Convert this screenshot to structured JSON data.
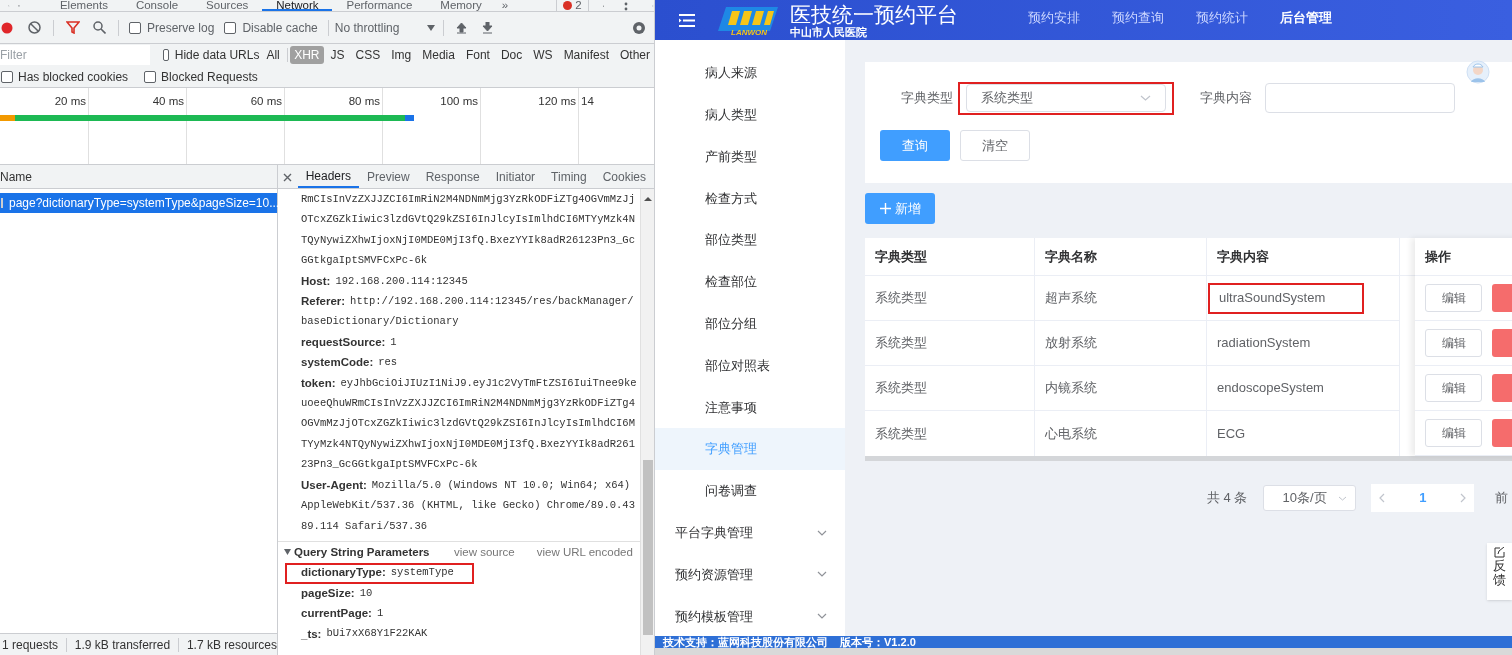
{
  "devtools": {
    "tabs": [
      {
        "label": "Elements",
        "selected": false
      },
      {
        "label": "Console",
        "selected": false
      },
      {
        "label": "Sources",
        "selected": false
      },
      {
        "label": "Network",
        "selected": true
      },
      {
        "label": "Performance",
        "selected": false
      },
      {
        "label": "Memory",
        "selected": false
      }
    ],
    "more_tabs": "»",
    "error_count": "2",
    "toolbar": {
      "recording": true,
      "checkboxes": [
        {
          "label": "Preserve log",
          "checked": false
        },
        {
          "label": "Disable cache",
          "checked": false
        }
      ],
      "throttling": "No throttling"
    },
    "filter": {
      "placeholder": "Filter",
      "hide_data_urls": {
        "label": "Hide data URLs",
        "checked": false
      },
      "types": [
        {
          "label": "All",
          "selected": false
        },
        {
          "label": "XHR",
          "selected": true
        },
        {
          "label": "JS",
          "selected": false
        },
        {
          "label": "CSS",
          "selected": false
        },
        {
          "label": "Img",
          "selected": false
        },
        {
          "label": "Media",
          "selected": false
        },
        {
          "label": "Font",
          "selected": false
        },
        {
          "label": "Doc",
          "selected": false
        },
        {
          "label": "WS",
          "selected": false
        },
        {
          "label": "Manifest",
          "selected": false
        },
        {
          "label": "Other",
          "selected": false
        }
      ],
      "blocked": [
        {
          "label": "Has blocked cookies",
          "checked": false
        },
        {
          "label": "Blocked Requests",
          "checked": false
        }
      ]
    },
    "timeline": {
      "ticks": [
        "20 ms",
        "40 ms",
        "60 ms",
        "80 ms",
        "100 ms",
        "120 ms",
        "14"
      ]
    },
    "requests": {
      "column": "Name",
      "rows": [
        {
          "name": "page?dictionaryType=systemType&pageSize=10...",
          "selected": true
        }
      ]
    },
    "detail_tabs": [
      {
        "label": "Headers",
        "selected": true
      },
      {
        "label": "Preview",
        "selected": false
      },
      {
        "label": "Response",
        "selected": false
      },
      {
        "label": "Initiator",
        "selected": false
      },
      {
        "label": "Timing",
        "selected": false
      },
      {
        "label": "Cookies",
        "selected": false
      }
    ],
    "headers": [
      {
        "value": "RmCIsInVzZXJJZCI6ImRiN2M4NDNmMjg3YzRkODFiZTg4OGVmMzJjOTcxZGZkIiwic3lzdGVtQ29kZSI6InJlcyIsImlhdCI6MTYyMzk4NTQyNywiZXhwIjoxNjI0MDE0MjI3fQ.BxezYYIk8adR26123Pn3_GcGGtkgaIptSMVFCxPc-6k"
      },
      {
        "name": "Host:",
        "value": "192.168.200.114:12345"
      },
      {
        "name": "Referer:",
        "value": "http://192.168.200.114:12345/res/backManager/baseDictionary/Dictionary"
      },
      {
        "name": "requestSource:",
        "value": "1"
      },
      {
        "name": "systemCode:",
        "value": "res"
      },
      {
        "name": "token:",
        "value": "eyJhbGciOiJIUzI1NiJ9.eyJ1c2VyTmFtZSI6IuiTnee9keuoeeQhuWRmCIsInVzZXJJZCI6ImRiN2M4NDNmMjg3YzRkODFiZTg4OGVmMzJjOTcxZGZkIiwic3lzdGVtQ29kZSI6InJlcyIsImlhdCI6MTYyMzk4NTQyNywiZXhwIjoxNjI0MDE0MjI3fQ.BxezYYIk8adR26123Pn3_GcGGtkgaIptSMVFCxPc-6k"
      },
      {
        "name": "User-Agent:",
        "value": "Mozilla/5.0 (Windows NT 10.0; Win64; x64) AppleWebKit/537.36 (KHTML, like Gecko) Chrome/89.0.4389.114 Safari/537.36"
      }
    ],
    "query": {
      "title": "Query String Parameters",
      "expanded": true,
      "links": [
        "view source",
        "view URL encoded"
      ],
      "params": [
        {
          "name": "dictionaryType:",
          "value": "systemType",
          "highlighted": true
        },
        {
          "name": "pageSize:",
          "value": "10",
          "highlighted": false
        },
        {
          "name": "currentPage:",
          "value": "1",
          "highlighted": false
        },
        {
          "name": "_ts:",
          "value": "bUi7xX68Y1F22KAK",
          "highlighted": false
        }
      ]
    },
    "status": [
      "1 requests",
      "1.9 kB transferred",
      "1.7 kB resources"
    ]
  },
  "app": {
    "header": {
      "logo_text": "LANWON",
      "title": "医技统一预约平台",
      "subtitle": "中山市人民医院",
      "nav": [
        {
          "label": "预约安排",
          "selected": false
        },
        {
          "label": "预约查询",
          "selected": false
        },
        {
          "label": "预约统计",
          "selected": false
        },
        {
          "label": "后台管理",
          "selected": true
        }
      ]
    },
    "sidebar": [
      {
        "label": "病人来源",
        "kind": "item",
        "selected": false
      },
      {
        "label": "病人类型",
        "kind": "item",
        "selected": false
      },
      {
        "label": "产前类型",
        "kind": "item",
        "selected": false
      },
      {
        "label": "检查方式",
        "kind": "item",
        "selected": false
      },
      {
        "label": "部位类型",
        "kind": "item",
        "selected": false
      },
      {
        "label": "检查部位",
        "kind": "item",
        "selected": false
      },
      {
        "label": "部位分组",
        "kind": "item",
        "selected": false
      },
      {
        "label": "部位对照表",
        "kind": "item",
        "selected": false
      },
      {
        "label": "注意事项",
        "kind": "item",
        "selected": false
      },
      {
        "label": "字典管理",
        "kind": "item",
        "selected": true
      },
      {
        "label": "问卷调查",
        "kind": "item",
        "selected": false
      },
      {
        "label": "平台字典管理",
        "kind": "group",
        "selected": false
      },
      {
        "label": "预约资源管理",
        "kind": "group",
        "selected": false
      },
      {
        "label": "预约模板管理",
        "kind": "group",
        "selected": false
      }
    ],
    "filters": {
      "type": {
        "label": "字典类型",
        "value": "系统类型",
        "highlighted": true
      },
      "content": {
        "label": "字典内容"
      },
      "buttons": [
        "查询",
        "清空"
      ]
    },
    "add_button": "新增",
    "table": {
      "columns": [
        "字典类型",
        "字典名称",
        "字典内容"
      ],
      "actions_column": "操作",
      "rows": [
        {
          "type": "系统类型",
          "name": "超声系统",
          "content": "ultraSoundSystem",
          "highlighted": true,
          "edit": "编辑"
        },
        {
          "type": "系统类型",
          "name": "放射系统",
          "content": "radiationSystem",
          "highlighted": false,
          "edit": "编辑"
        },
        {
          "type": "系统类型",
          "name": "内镜系统",
          "content": "endoscopeSystem",
          "highlighted": false,
          "edit": "编辑"
        },
        {
          "type": "系统类型",
          "name": "心电系统",
          "content": "ECG",
          "highlighted": false,
          "edit": "编辑"
        }
      ]
    },
    "pagination": {
      "total": "共 4 条",
      "page_size": "10条/页",
      "pages": [
        {
          "label": "1",
          "selected": true
        }
      ],
      "goto": "前"
    },
    "feedback": "反馈",
    "footer": [
      "技术支持：蓝网科技股份有限公司",
      "版本号：V1.2.0"
    ]
  }
}
